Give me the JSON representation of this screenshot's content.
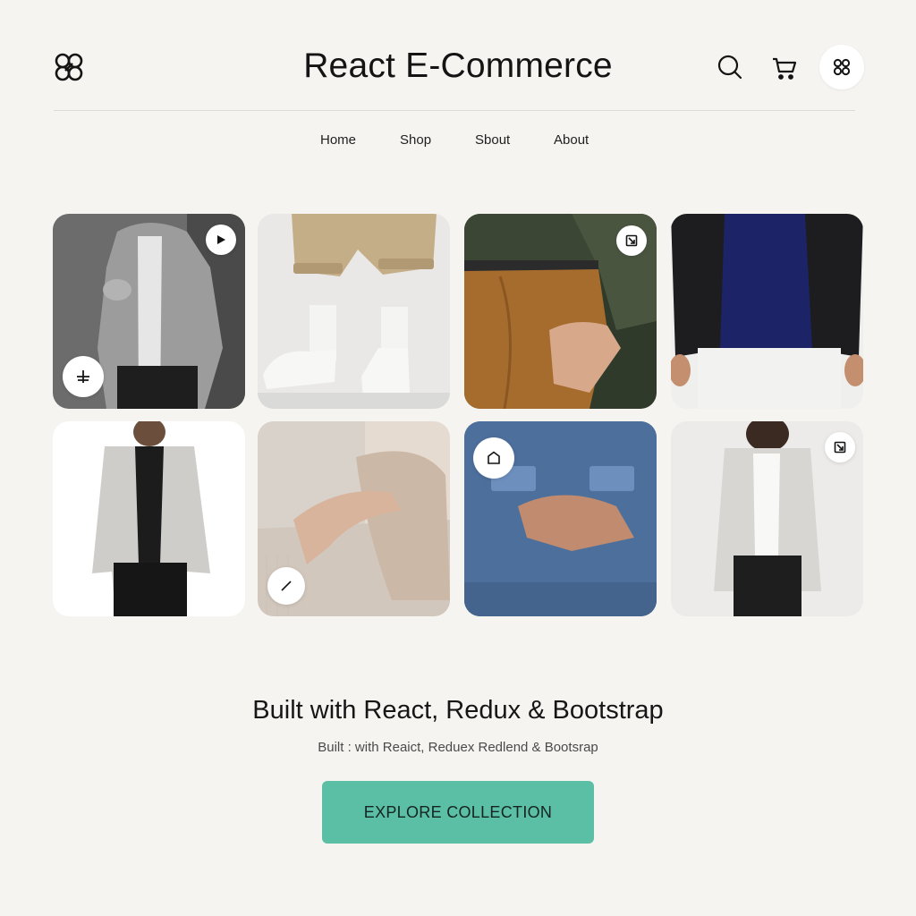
{
  "header": {
    "brand": "React E-Commerce",
    "logo_icon": "clover-logo-icon",
    "icons": [
      "search-icon",
      "cart-icon",
      "grid-icon"
    ]
  },
  "nav": {
    "items": [
      {
        "label": "Home"
      },
      {
        "label": "Shop"
      },
      {
        "label": "Sbout"
      },
      {
        "label": "About"
      }
    ]
  },
  "products": [
    {
      "image": "grey zip jacket",
      "badge_icon": "play-icon",
      "second_badge_icon": "plus-icon"
    },
    {
      "image": "khaki shorts and white sneakers"
    },
    {
      "image": "brown trousers with olive jacket",
      "badge_icon": "expand-icon"
    },
    {
      "image": "black puffer jacket with navy top"
    },
    {
      "image": "light grey bomber jacket"
    },
    {
      "image": "beige knit sweater sleeve",
      "badge_icon": "slash-icon"
    },
    {
      "image": "blue denim jacket",
      "badge_icon": "tag-icon"
    },
    {
      "image": "white shirt jacket",
      "badge_icon": "expand-icon"
    }
  ],
  "hero": {
    "headline": "Built with React, Redux & Bootstrap",
    "subline": "Built : with Reaict, Reduex Redlend & Bootsrap",
    "cta_label": "EXPLORE COLLECTION"
  },
  "colors": {
    "background": "#f6f4f1",
    "accent": "#5bbfa6",
    "text": "#161616"
  }
}
